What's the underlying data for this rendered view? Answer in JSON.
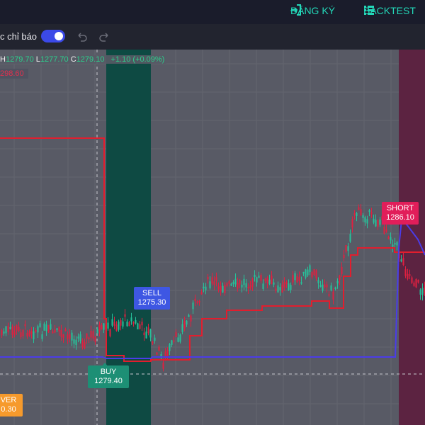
{
  "header": {
    "register_label": "ĐĂNG KÝ",
    "backtest_label": "BACKTEST"
  },
  "toolbar": {
    "indicator_label": "c chỉ báo"
  },
  "ohlc": {
    "h_label": "H",
    "h": "1279.70",
    "l_label": "L",
    "l": "1277.70",
    "c_label": "C",
    "c": "1279.10",
    "change": "+1.10 (+0.09%)"
  },
  "level_label": "298.60",
  "signals": {
    "sell": {
      "label": "SELL",
      "price": "1275.30"
    },
    "buy": {
      "label": "BUY",
      "price": "1279.40"
    },
    "short": {
      "label": "SHORT",
      "price": "1286.10"
    },
    "cover": {
      "label": "VER",
      "price": "0.30"
    }
  },
  "colors": {
    "accent": "#23d7b8",
    "red_line": "#e11e2e",
    "blue_line": "#4b3ce8",
    "up": "#26c29a",
    "down": "#e02040",
    "buy_zone": "#0e4a43",
    "short_zone": "#5c2341"
  }
}
